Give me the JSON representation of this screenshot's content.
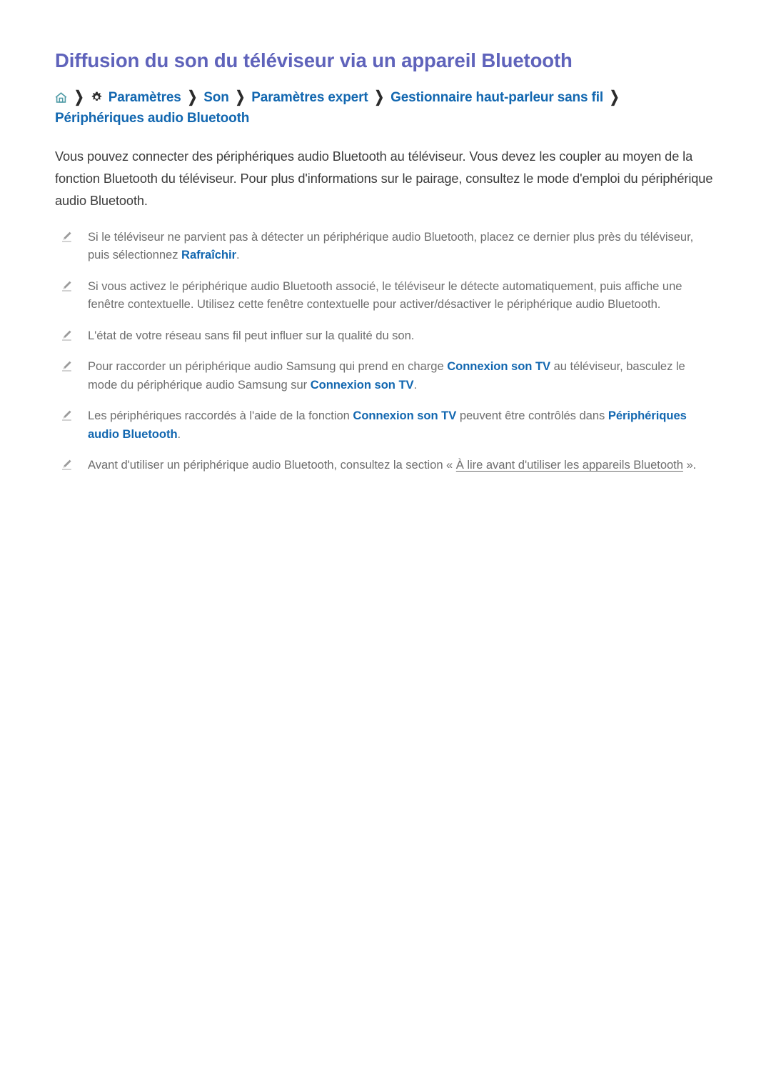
{
  "page": {
    "title": "Diffusion du son du téléviseur via un appareil Bluetooth",
    "title_color": "#5f63bb",
    "link_color": "#1267b0",
    "body_color": "#3b3b3b",
    "note_color": "#6e6e6e",
    "home_icon_color": "#4d9aa5"
  },
  "breadcrumb": {
    "home_icon": "home-icon",
    "gear_icon": "gear-icon",
    "separator": "❯",
    "items": [
      {
        "label": "Paramètres",
        "icon": "gear-icon"
      },
      {
        "label": "Son",
        "icon": null
      },
      {
        "label": "Paramètres expert",
        "icon": null
      },
      {
        "label": "Gestionnaire haut-parleur sans fil",
        "icon": null
      },
      {
        "label": "Périphériques audio Bluetooth",
        "icon": null
      }
    ]
  },
  "intro": {
    "text": "Vous pouvez connecter des périphériques audio Bluetooth au téléviseur. Vous devez les coupler au moyen de la fonction Bluetooth du téléviseur. Pour plus d'informations sur le pairage, consultez le mode d'emploi du périphérique audio Bluetooth."
  },
  "notes": [
    {
      "icon": "pencil-icon",
      "parts": [
        {
          "type": "text",
          "text": "Si le téléviseur ne parvient pas à détecter un périphérique audio Bluetooth, placez ce dernier plus près du téléviseur, puis sélectionnez "
        },
        {
          "type": "highlight",
          "text": "Rafraîchir"
        },
        {
          "type": "text",
          "text": "."
        }
      ]
    },
    {
      "icon": "pencil-icon",
      "parts": [
        {
          "type": "text",
          "text": "Si vous activez le périphérique audio Bluetooth associé, le téléviseur le détecte automatiquement, puis affiche une fenêtre contextuelle. Utilisez cette fenêtre contextuelle pour activer/désactiver le périphérique audio Bluetooth."
        }
      ]
    },
    {
      "icon": "pencil-icon",
      "parts": [
        {
          "type": "text",
          "text": "L'état de votre réseau sans fil peut influer sur la qualité du son."
        }
      ]
    },
    {
      "icon": "pencil-icon",
      "parts": [
        {
          "type": "text",
          "text": "Pour raccorder un périphérique audio Samsung qui prend en charge "
        },
        {
          "type": "highlight",
          "text": "Connexion son TV"
        },
        {
          "type": "text",
          "text": " au téléviseur, basculez le mode du périphérique audio Samsung sur "
        },
        {
          "type": "highlight",
          "text": "Connexion son TV"
        },
        {
          "type": "text",
          "text": "."
        }
      ]
    },
    {
      "icon": "pencil-icon",
      "parts": [
        {
          "type": "text",
          "text": "Les périphériques raccordés à l'aide de la fonction "
        },
        {
          "type": "highlight",
          "text": "Connexion son TV"
        },
        {
          "type": "text",
          "text": " peuvent être contrôlés dans "
        },
        {
          "type": "highlight",
          "text": "Périphériques audio Bluetooth"
        },
        {
          "type": "text",
          "text": "."
        }
      ]
    },
    {
      "icon": "pencil-icon",
      "parts": [
        {
          "type": "text",
          "text": "Avant d'utiliser un périphérique audio Bluetooth, consultez la section « "
        },
        {
          "type": "underline-link",
          "text": "À lire avant d'utiliser les appareils Bluetooth"
        },
        {
          "type": "text",
          "text": " »."
        }
      ]
    }
  ]
}
